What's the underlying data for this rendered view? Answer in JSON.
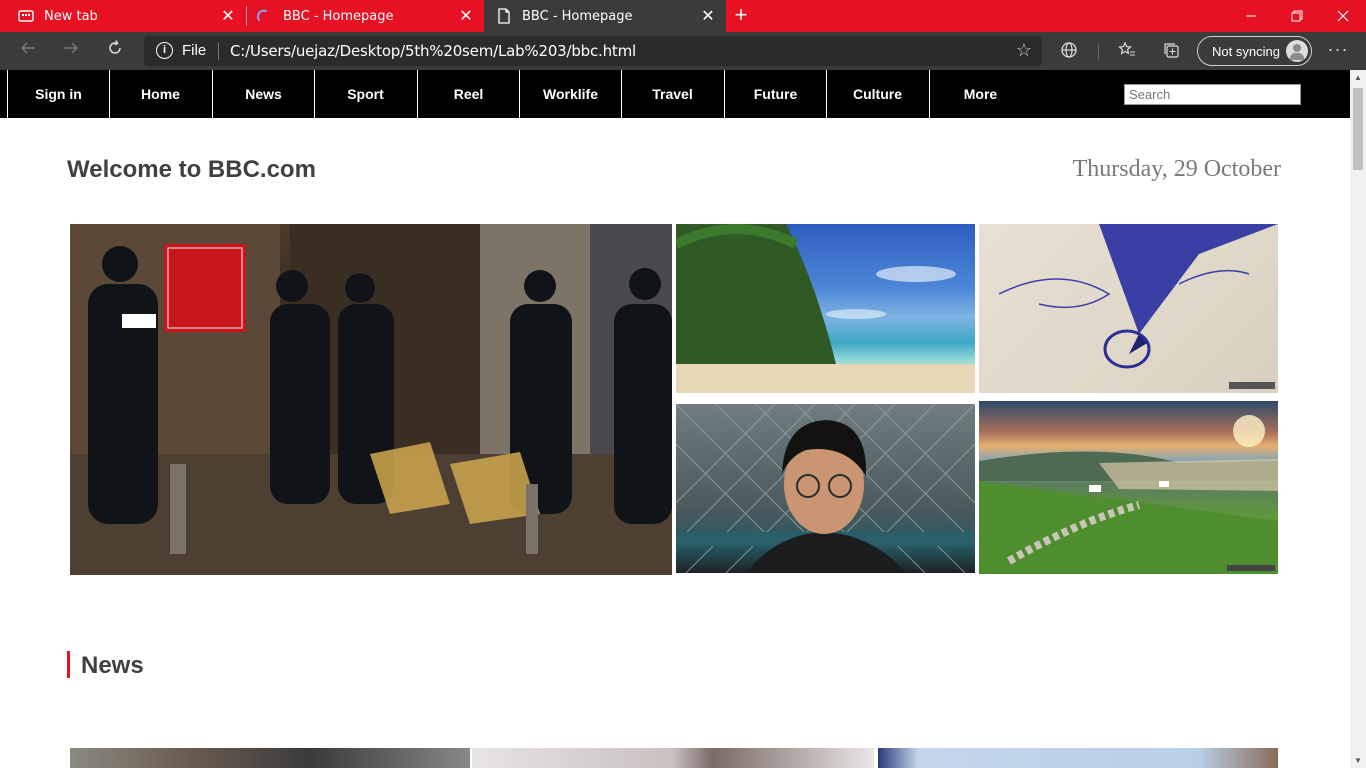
{
  "browser": {
    "tabs": [
      {
        "label": "New tab",
        "icon": "new-tab-icon"
      },
      {
        "label": "BBC - Homepage",
        "icon": "loading-spinner-icon"
      },
      {
        "label": "BBC - Homepage",
        "icon": "page-icon",
        "active": true
      }
    ],
    "address": {
      "scheme_label": "File",
      "url": "C:/Users/uejaz/Desktop/5th%20sem/Lab%203/bbc.html"
    },
    "sync_label": "Not syncing",
    "colors": {
      "titlebar": "#e81123",
      "toolbar": "#3b3b3b"
    }
  },
  "bbc": {
    "nav": {
      "items": [
        "Sign in",
        "Home",
        "News",
        "Sport",
        "Reel",
        "Worklife",
        "Travel",
        "Future",
        "Culture",
        "More"
      ],
      "search_placeholder": "Search"
    },
    "welcome": "Welcome to BBC.com",
    "date": "Thursday, 29 October",
    "images": [
      {
        "name": "police-restaurant-photo",
        "description_icon": "photo"
      },
      {
        "name": "tropical-beach-photo"
      },
      {
        "name": "pen-drawing-photo"
      },
      {
        "name": "young-man-portrait-photo"
      },
      {
        "name": "coastal-landscape-photo"
      }
    ],
    "section_title": "News",
    "accent_color": "#e81123"
  }
}
